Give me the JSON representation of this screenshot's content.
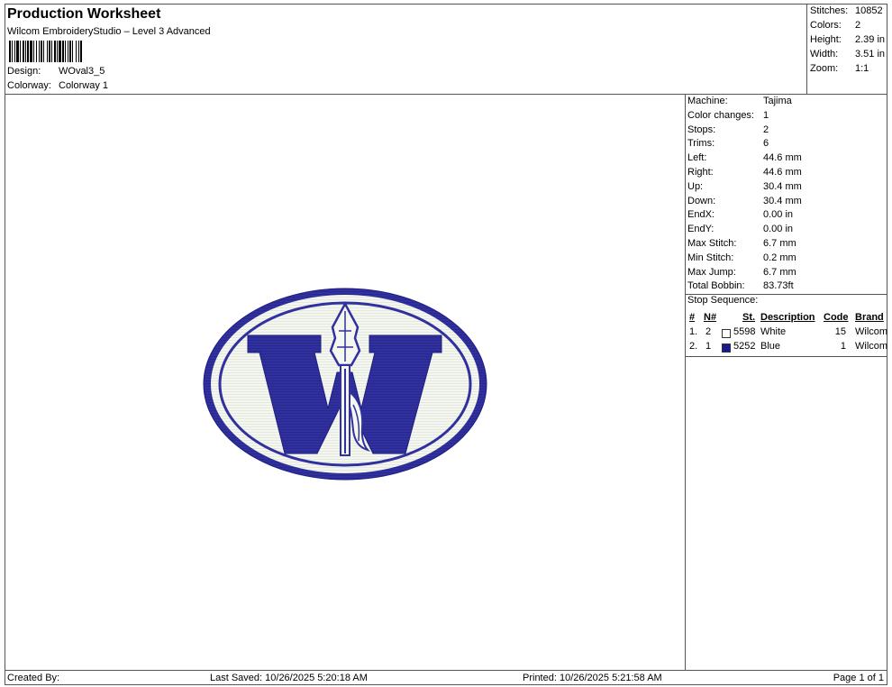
{
  "header": {
    "title": "Production Worksheet",
    "subtitle": "Wilcom EmbroideryStudio – Level 3 Advanced",
    "design_label": "Design:",
    "design_value": "WOval3_5",
    "colorway_label": "Colorway:",
    "colorway_value": "Colorway 1"
  },
  "stats": [
    {
      "label": "Stitches:",
      "value": "10852"
    },
    {
      "label": "Colors:",
      "value": "2"
    },
    {
      "label": "Height:",
      "value": "2.39 in"
    },
    {
      "label": "Width:",
      "value": "3.51 in"
    },
    {
      "label": "Zoom:",
      "value": "1:1"
    }
  ],
  "info": [
    {
      "label": "Machine:",
      "value": "Tajima"
    },
    {
      "label": "Color changes:",
      "value": "1"
    },
    {
      "label": "Stops:",
      "value": "2"
    },
    {
      "label": "Trims:",
      "value": "6"
    },
    {
      "label": "Left:",
      "value": "44.6 mm"
    },
    {
      "label": "Right:",
      "value": "44.6 mm"
    },
    {
      "label": "Up:",
      "value": "30.4 mm"
    },
    {
      "label": "Down:",
      "value": "30.4 mm"
    },
    {
      "label": "EndX:",
      "value": "0.00 in"
    },
    {
      "label": "EndY:",
      "value": "0.00 in"
    },
    {
      "label": "Max Stitch:",
      "value": "6.7 mm"
    },
    {
      "label": "Min Stitch:",
      "value": "0.2 mm"
    },
    {
      "label": "Max Jump:",
      "value": "6.7 mm"
    },
    {
      "label": "Total Bobbin:",
      "value": "83.73ft"
    }
  ],
  "stop_sequence": {
    "title": "Stop Sequence:",
    "headers": {
      "num": "#",
      "n": "N#",
      "st": "St.",
      "desc": "Description",
      "code": "Code",
      "brand": "Brand"
    },
    "rows": [
      {
        "num": "1.",
        "n": "2",
        "swatch": "#ffffff",
        "st": "5598",
        "desc": "White",
        "code": "15",
        "brand": "Wilcom"
      },
      {
        "num": "2.",
        "n": "1",
        "swatch": "#1a1a8c",
        "st": "5252",
        "desc": "Blue",
        "code": "1",
        "brand": "Wilcom"
      }
    ]
  },
  "colors": {
    "blue": "#2e2ea6",
    "white": "#f4f6f0"
  },
  "footer": {
    "created": "Created By:",
    "saved": "Last Saved: 10/26/2025 5:20:18 AM",
    "printed": "Printed: 10/26/2025 5:21:58 AM",
    "page": "Page 1 of 1"
  }
}
